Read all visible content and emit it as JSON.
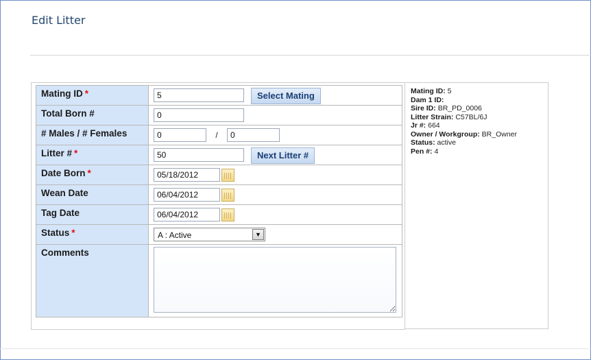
{
  "header": {
    "title": "Edit Litter"
  },
  "form": {
    "mating_id": {
      "label": "Mating ID",
      "value": "5",
      "button": "Select Mating"
    },
    "total_born": {
      "label": "Total Born #",
      "value": "0"
    },
    "males_females": {
      "label": "# Males / # Females",
      "males": "0",
      "separator": "/",
      "females": "0"
    },
    "litter_no": {
      "label": "Litter #",
      "value": "50",
      "button": "Next Litter #"
    },
    "date_born": {
      "label": "Date Born",
      "value": "05/18/2012"
    },
    "wean_date": {
      "label": "Wean Date",
      "value": "06/04/2012"
    },
    "tag_date": {
      "label": "Tag Date",
      "value": "06/04/2012"
    },
    "status": {
      "label": "Status",
      "value": "A : Active"
    },
    "comments": {
      "label": "Comments",
      "value": ""
    },
    "required_mark": "*"
  },
  "summary": {
    "items": [
      {
        "key": "Mating ID:",
        "value": "5"
      },
      {
        "key": "Dam 1 ID:",
        "value": ""
      },
      {
        "key": "Sire ID:",
        "value": "BR_PD_0006"
      },
      {
        "key": "Litter Strain:",
        "value": "C57BL/6J"
      },
      {
        "key": "Jr #:",
        "value": "664"
      },
      {
        "key": "Owner / Workgroup:",
        "value": "BR_Owner"
      },
      {
        "key": "Status:",
        "value": "active"
      },
      {
        "key": "Pen #:",
        "value": "4"
      }
    ]
  },
  "icons": {
    "calendar": "calendar-icon",
    "dropdown": "chevron-down-icon"
  },
  "colors": {
    "label_bg": "#d5e5f9",
    "title": "#25476f",
    "required": "#e01010",
    "button_text": "#1a3f75"
  }
}
